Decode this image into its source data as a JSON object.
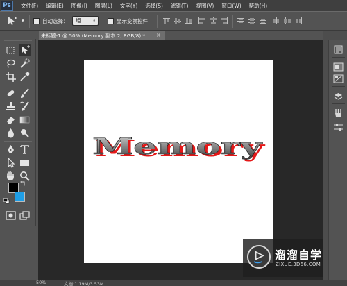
{
  "app": {
    "logo_text": "Ps"
  },
  "menu": [
    "文件(F)",
    "编辑(E)",
    "图像(I)",
    "图层(L)",
    "文字(Y)",
    "选择(S)",
    "滤镜(T)",
    "视图(V)",
    "窗口(W)",
    "帮助(H)"
  ],
  "options_bar": {
    "auto_select_label": "自动选择：",
    "auto_select_checked": false,
    "auto_select_value": "组",
    "show_transform_label": "显示变换控件",
    "show_transform_checked": false
  },
  "document_tab": {
    "title": "未标题-1 @ 50% (Memory 副本 2, RGB/8) *",
    "close_glyph": "×"
  },
  "canvas": {
    "art_text": "Memory",
    "text_colors": {
      "face_top": "#d9d9d9",
      "face_mid": "#8a8a8a",
      "face_bottom": "#3c3c3c",
      "shadow": "#e41818"
    }
  },
  "colors": {
    "foreground": "#000000",
    "background": "#1e9ee6"
  },
  "status": {
    "zoom": "50%",
    "doc_info": "文档:1.19M/3.53M"
  },
  "watermark": {
    "title": "溜溜自学",
    "url": "ZIXUE.3D66.COM"
  },
  "icons": {
    "toolbar": [
      "move-tool-icon",
      "marquee-icon",
      "lasso-icon",
      "quick-select-icon",
      "crop-icon",
      "eyedropper-icon",
      "healing-brush-icon",
      "brush-icon",
      "clone-stamp-icon",
      "history-brush-icon",
      "eraser-icon",
      "gradient-icon",
      "blur-icon",
      "dodge-icon",
      "pen-icon",
      "type-icon",
      "path-select-icon",
      "rectangle-icon",
      "hand-icon",
      "zoom-icon",
      "quick-mask-icon",
      "screen-mode-icon"
    ],
    "panels": [
      "history-panel-icon",
      "color-panel-icon",
      "adjustments-panel-icon",
      "layers-panel-icon",
      "properties-panel-icon",
      "brush-panel-icon",
      "tools-preset-icon"
    ]
  }
}
